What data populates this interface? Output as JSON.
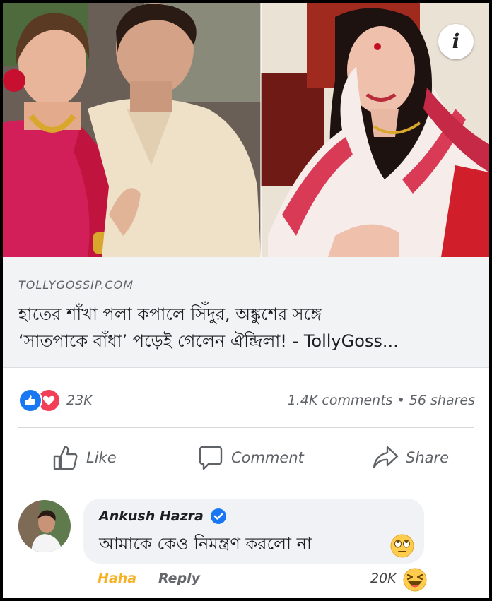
{
  "post": {
    "info_icon": "i",
    "link": {
      "domain": "TOLLYGOSSIP.COM",
      "headline_line1": "হাতের শাঁখা পলা কপালে সিঁদুর, অঙ্কুশের সঙ্গে",
      "headline_line2": "‘সাতপাকে বাঁধা’ পড়েই গেলেন ঐন্দ্রিলা! - TollyGoss..."
    },
    "stats": {
      "reaction_icons": [
        "like-reaction-icon",
        "love-reaction-icon"
      ],
      "reaction_count": "23K",
      "comments": "1.4K comments",
      "separator": "•",
      "shares": "56 shares"
    },
    "actions": {
      "like": "Like",
      "comment": "Comment",
      "share": "Share"
    },
    "comment": {
      "author": "Ankush Hazra",
      "text": "আমাকে কেও নিমন্ত্রণ করলো না",
      "reaction_label": "Haha",
      "reply_label": "Reply",
      "reaction_count": "20K"
    }
  },
  "colors": {
    "facebook_blue": "#1877f2",
    "love_red": "#f33e58",
    "haha_yellow": "#f7b125",
    "link_bg": "#f2f3f5",
    "bubble_bg": "#f0f2f5"
  }
}
